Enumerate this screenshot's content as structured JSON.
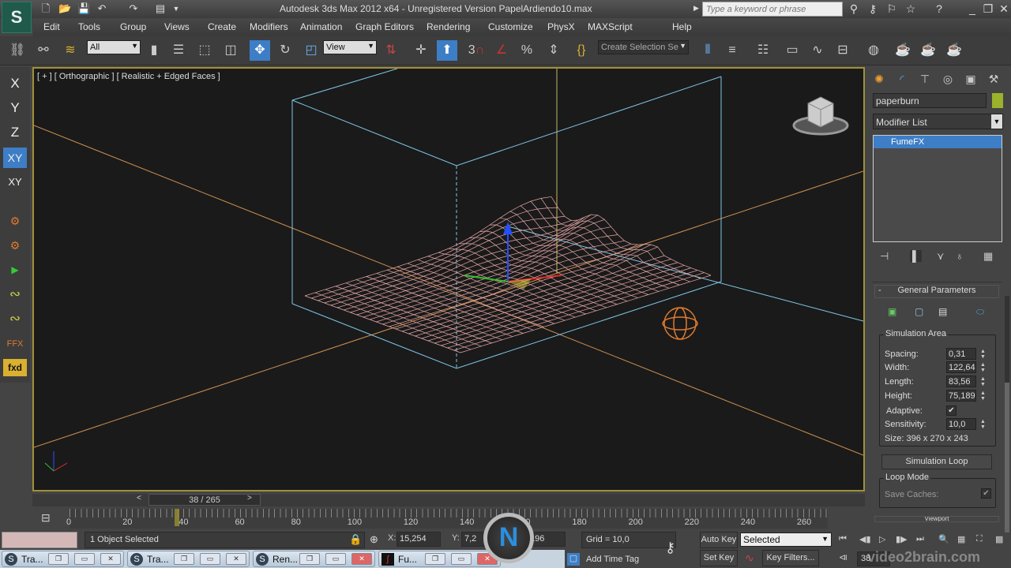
{
  "titlebar": {
    "title": "Autodesk 3ds Max  2012 x64  - Unregistered Version   PapelArdiendo10.max",
    "search_placeholder": "Type a keyword or phrase",
    "logo": "S"
  },
  "menu": [
    "Edit",
    "Tools",
    "Group",
    "Views",
    "Create",
    "Modifiers",
    "Animation",
    "Graph Editors",
    "Rendering",
    "Customize",
    "PhysX",
    "MAXScript",
    "Help"
  ],
  "toolbar": {
    "selection_filter": "All",
    "ref_coord": "View",
    "named_selection_placeholder": "Create Selection Se",
    "snap_label": "3"
  },
  "left_toolbar": {
    "axes": [
      "X",
      "Y",
      "Z",
      "XY",
      "XY"
    ],
    "fx_labels": [
      "FFX",
      "fxd"
    ]
  },
  "viewport": {
    "label": "[ + ] [ Orthographic ] [ Realistic + Edged Faces ]",
    "active_border_color": "#a09038",
    "mesh_color": "#e8a8a8",
    "box_color": "#7ec8e8"
  },
  "command_panel": {
    "object_name": "paperburn",
    "object_color": "#9ab22c",
    "modifier_list": "Modifier List",
    "stack": [
      "FumeFX"
    ],
    "rollout_title": "General Parameters",
    "simulation_area": {
      "title": "Simulation Area",
      "params": [
        {
          "label": "Spacing:",
          "value": "0,31"
        },
        {
          "label": "Width:",
          "value": "122,64"
        },
        {
          "label": "Length:",
          "value": "83,56"
        },
        {
          "label": "Height:",
          "value": "75,189"
        }
      ],
      "adaptive_label": "Adaptive:",
      "adaptive_checked": true,
      "sensitivity_label": "Sensitivity:",
      "sensitivity_value": "10,0",
      "size": "Size:  396 x 270 x 243"
    },
    "simulation_loop": "Simulation Loop",
    "loop_mode": {
      "title": "Loop Mode",
      "save_caches": "Save Caches:",
      "save_caches_checked": true
    },
    "next_rollout": "Viewport"
  },
  "timeline": {
    "slider": "38 / 265",
    "current_frame": 38,
    "total_frames": 265,
    "ticks": [
      "0",
      "20",
      "40",
      "60",
      "80",
      "100",
      "120",
      "140",
      "160",
      "180",
      "200",
      "220",
      "240",
      "260"
    ]
  },
  "status": {
    "selection": "1 Object Selected",
    "x_label": "X:",
    "x": "15,254",
    "y_label": "Y:",
    "y": "7,2",
    "z_label": "Z:",
    "z": ",196",
    "grid": "Grid = 10,0",
    "add_time_tag": "Add Time Tag"
  },
  "animation": {
    "auto_key": "Auto Key",
    "set_key": "Set Key",
    "key_mode": "Selected",
    "key_filters": "Key Filters...",
    "frame": "38"
  },
  "taskbar": [
    {
      "label": "Tra..."
    },
    {
      "label": "Tra..."
    },
    {
      "label": "Ren..."
    },
    {
      "label": "Fu..."
    }
  ],
  "watermark": "video2brain.com"
}
